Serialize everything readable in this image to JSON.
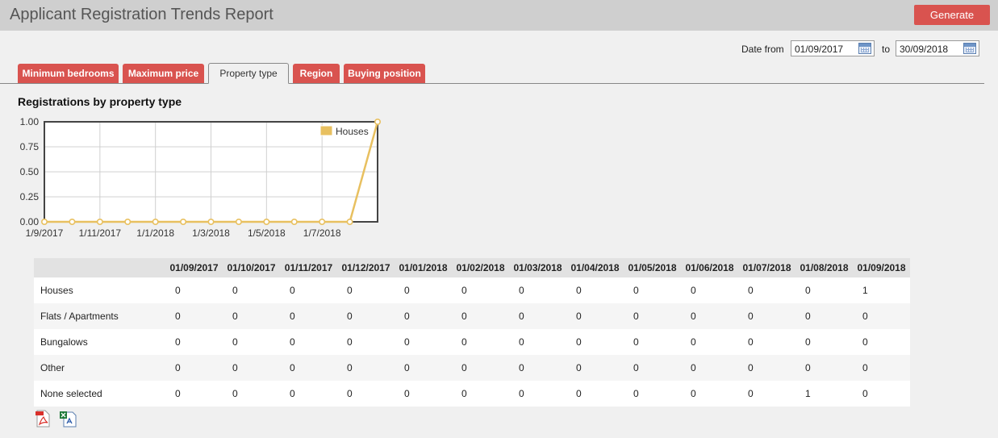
{
  "header": {
    "title": "Applicant Registration Trends Report",
    "generate_label": "Generate"
  },
  "dates": {
    "from_label": "Date from",
    "from_value": "01/09/2017",
    "to_label": "to",
    "to_value": "30/09/2018"
  },
  "tabs": [
    {
      "label": "Minimum bedrooms",
      "active": false
    },
    {
      "label": "Maximum price",
      "active": false
    },
    {
      "label": "Property type",
      "active": true
    },
    {
      "label": "Region",
      "active": false
    },
    {
      "label": "Buying position",
      "active": false
    }
  ],
  "chart_title": "Registrations by property type",
  "chart_data": {
    "type": "line",
    "title": "Registrations by property type",
    "xlabel": "",
    "ylabel": "",
    "x": [
      "01/09/2017",
      "01/10/2017",
      "01/11/2017",
      "01/12/2017",
      "01/01/2018",
      "01/02/2018",
      "01/03/2018",
      "01/04/2018",
      "01/05/2018",
      "01/06/2018",
      "01/07/2018",
      "01/08/2018",
      "01/09/2018"
    ],
    "x_tick_labels": [
      "1/9/2017",
      "1/11/2017",
      "1/1/2018",
      "1/3/2018",
      "1/5/2018",
      "1/7/2018"
    ],
    "y_tick_labels": [
      "1.00",
      "0.75",
      "0.50",
      "0.25",
      "0.00"
    ],
    "ylim": [
      0,
      1
    ],
    "grid": true,
    "legend_position": "top-right",
    "series": [
      {
        "name": "Houses",
        "color": "#e8c060",
        "values": [
          0,
          0,
          0,
          0,
          0,
          0,
          0,
          0,
          0,
          0,
          0,
          0,
          1
        ]
      }
    ]
  },
  "table": {
    "columns": [
      "01/09/2017",
      "01/10/2017",
      "01/11/2017",
      "01/12/2017",
      "01/01/2018",
      "01/02/2018",
      "01/03/2018",
      "01/04/2018",
      "01/05/2018",
      "01/06/2018",
      "01/07/2018",
      "01/08/2018",
      "01/09/2018"
    ],
    "rows": [
      {
        "label": "Houses",
        "values": [
          "0",
          "0",
          "0",
          "0",
          "0",
          "0",
          "0",
          "0",
          "0",
          "0",
          "0",
          "0",
          "1"
        ]
      },
      {
        "label": "Flats / Apartments",
        "values": [
          "0",
          "0",
          "0",
          "0",
          "0",
          "0",
          "0",
          "0",
          "0",
          "0",
          "0",
          "0",
          "0"
        ]
      },
      {
        "label": "Bungalows",
        "values": [
          "0",
          "0",
          "0",
          "0",
          "0",
          "0",
          "0",
          "0",
          "0",
          "0",
          "0",
          "0",
          "0"
        ]
      },
      {
        "label": "Other",
        "values": [
          "0",
          "0",
          "0",
          "0",
          "0",
          "0",
          "0",
          "0",
          "0",
          "0",
          "0",
          "0",
          "0"
        ]
      },
      {
        "label": "None selected",
        "values": [
          "0",
          "0",
          "0",
          "0",
          "0",
          "0",
          "0",
          "0",
          "0",
          "0",
          "0",
          "1",
          "0"
        ]
      }
    ]
  },
  "exports": {
    "pdf_icon": "pdf-export-icon",
    "excel_icon": "excel-export-icon"
  },
  "colors": {
    "accent": "#d9534f",
    "series": "#e8c060"
  }
}
